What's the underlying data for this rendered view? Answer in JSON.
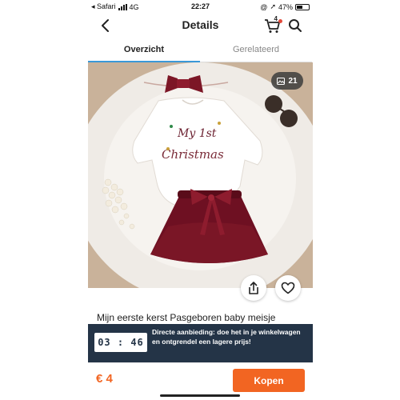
{
  "status_bar": {
    "carrier": "◂ Safari",
    "network": "4G",
    "time": "22:27",
    "battery": "47%",
    "battery_level": 0.47
  },
  "header": {
    "back_icon": "chevron-left-icon",
    "title": "Details",
    "cart_count": "4",
    "cart_icon": "cart-icon",
    "search_icon": "search-icon"
  },
  "tabs": [
    {
      "label": "Overzicht",
      "active": true
    },
    {
      "label": "Gerelateerd",
      "active": false
    }
  ],
  "gallery": {
    "image_count": "21",
    "image_alt": "Baby Christmas outfit: white onesie printed 'My 1st Christmas', burgundy tutu skirt and bow headband",
    "onesie_print_line1": "My 1st",
    "onesie_print_line2": "Christmas"
  },
  "product": {
    "title": "Mijn eerste kerst Pasgeboren baby meisje"
  },
  "deal": {
    "timer": "03 : 46",
    "text": "Directe aanbieding: doe het in je winkelwagen en ontgrendel een lagere prijs!"
  },
  "footer": {
    "price": "€ 4",
    "buy_label": "Kopen"
  },
  "colors": {
    "accent": "#f26522",
    "tab_underline": "#3a98d8",
    "deal_bg": "#243447",
    "cart_dot": "#e24b3c"
  }
}
